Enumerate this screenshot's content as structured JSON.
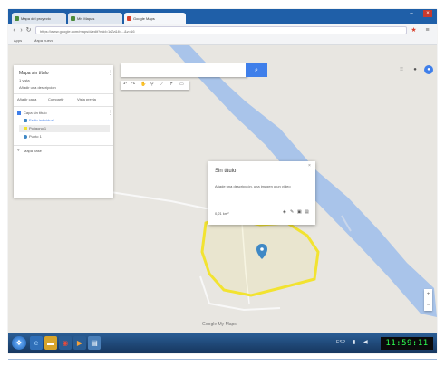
{
  "browser": {
    "tabs": [
      {
        "label": "Mapa del proyecto"
      },
      {
        "label": "Mis Mapas"
      },
      {
        "label": "Google Maps"
      }
    ],
    "url": "https://www.google.com/maps/d/edit?mid=1rZz&ll=...&z=16",
    "bookmarks": [
      "Apps",
      "Mapa nuevo"
    ]
  },
  "map": {
    "sidebar": {
      "title": "Mapa sin título",
      "subtitle": "1 vista",
      "description": "Añadir una descripción",
      "actions": [
        "Añadir capa",
        "Compartir",
        "Vista previa"
      ],
      "layer_title": "Capa sin título",
      "layer_style": "Estilo individual",
      "items": [
        "Polígono 1",
        "Punto 1"
      ],
      "basemap": "Mapa base"
    },
    "popup": {
      "title": "Sin título",
      "body": "Añade una descripción, una imagen o un vídeo",
      "footer": "0,21 km²"
    },
    "google_label": "Google My Maps"
  },
  "taskbar": {
    "clock": "11:59:11",
    "tray": "ESP"
  },
  "colors": {
    "river": "#a9c4ea",
    "polygon": "#f2e330",
    "marker": "#3f88c5",
    "search_button": "#3f7fea",
    "tabstrip": "#1f5fa8"
  }
}
